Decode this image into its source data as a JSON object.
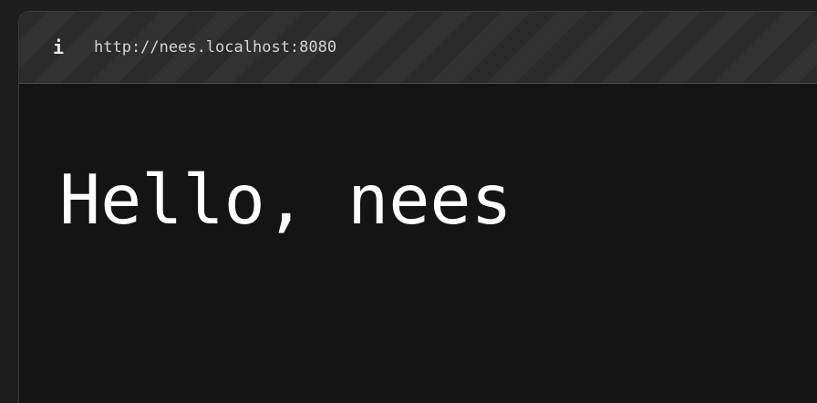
{
  "address_bar": {
    "info_icon": "info-icon",
    "info_glyph": "i",
    "url": "http://nees.localhost:8080"
  },
  "page": {
    "heading": "Hello, nees"
  }
}
